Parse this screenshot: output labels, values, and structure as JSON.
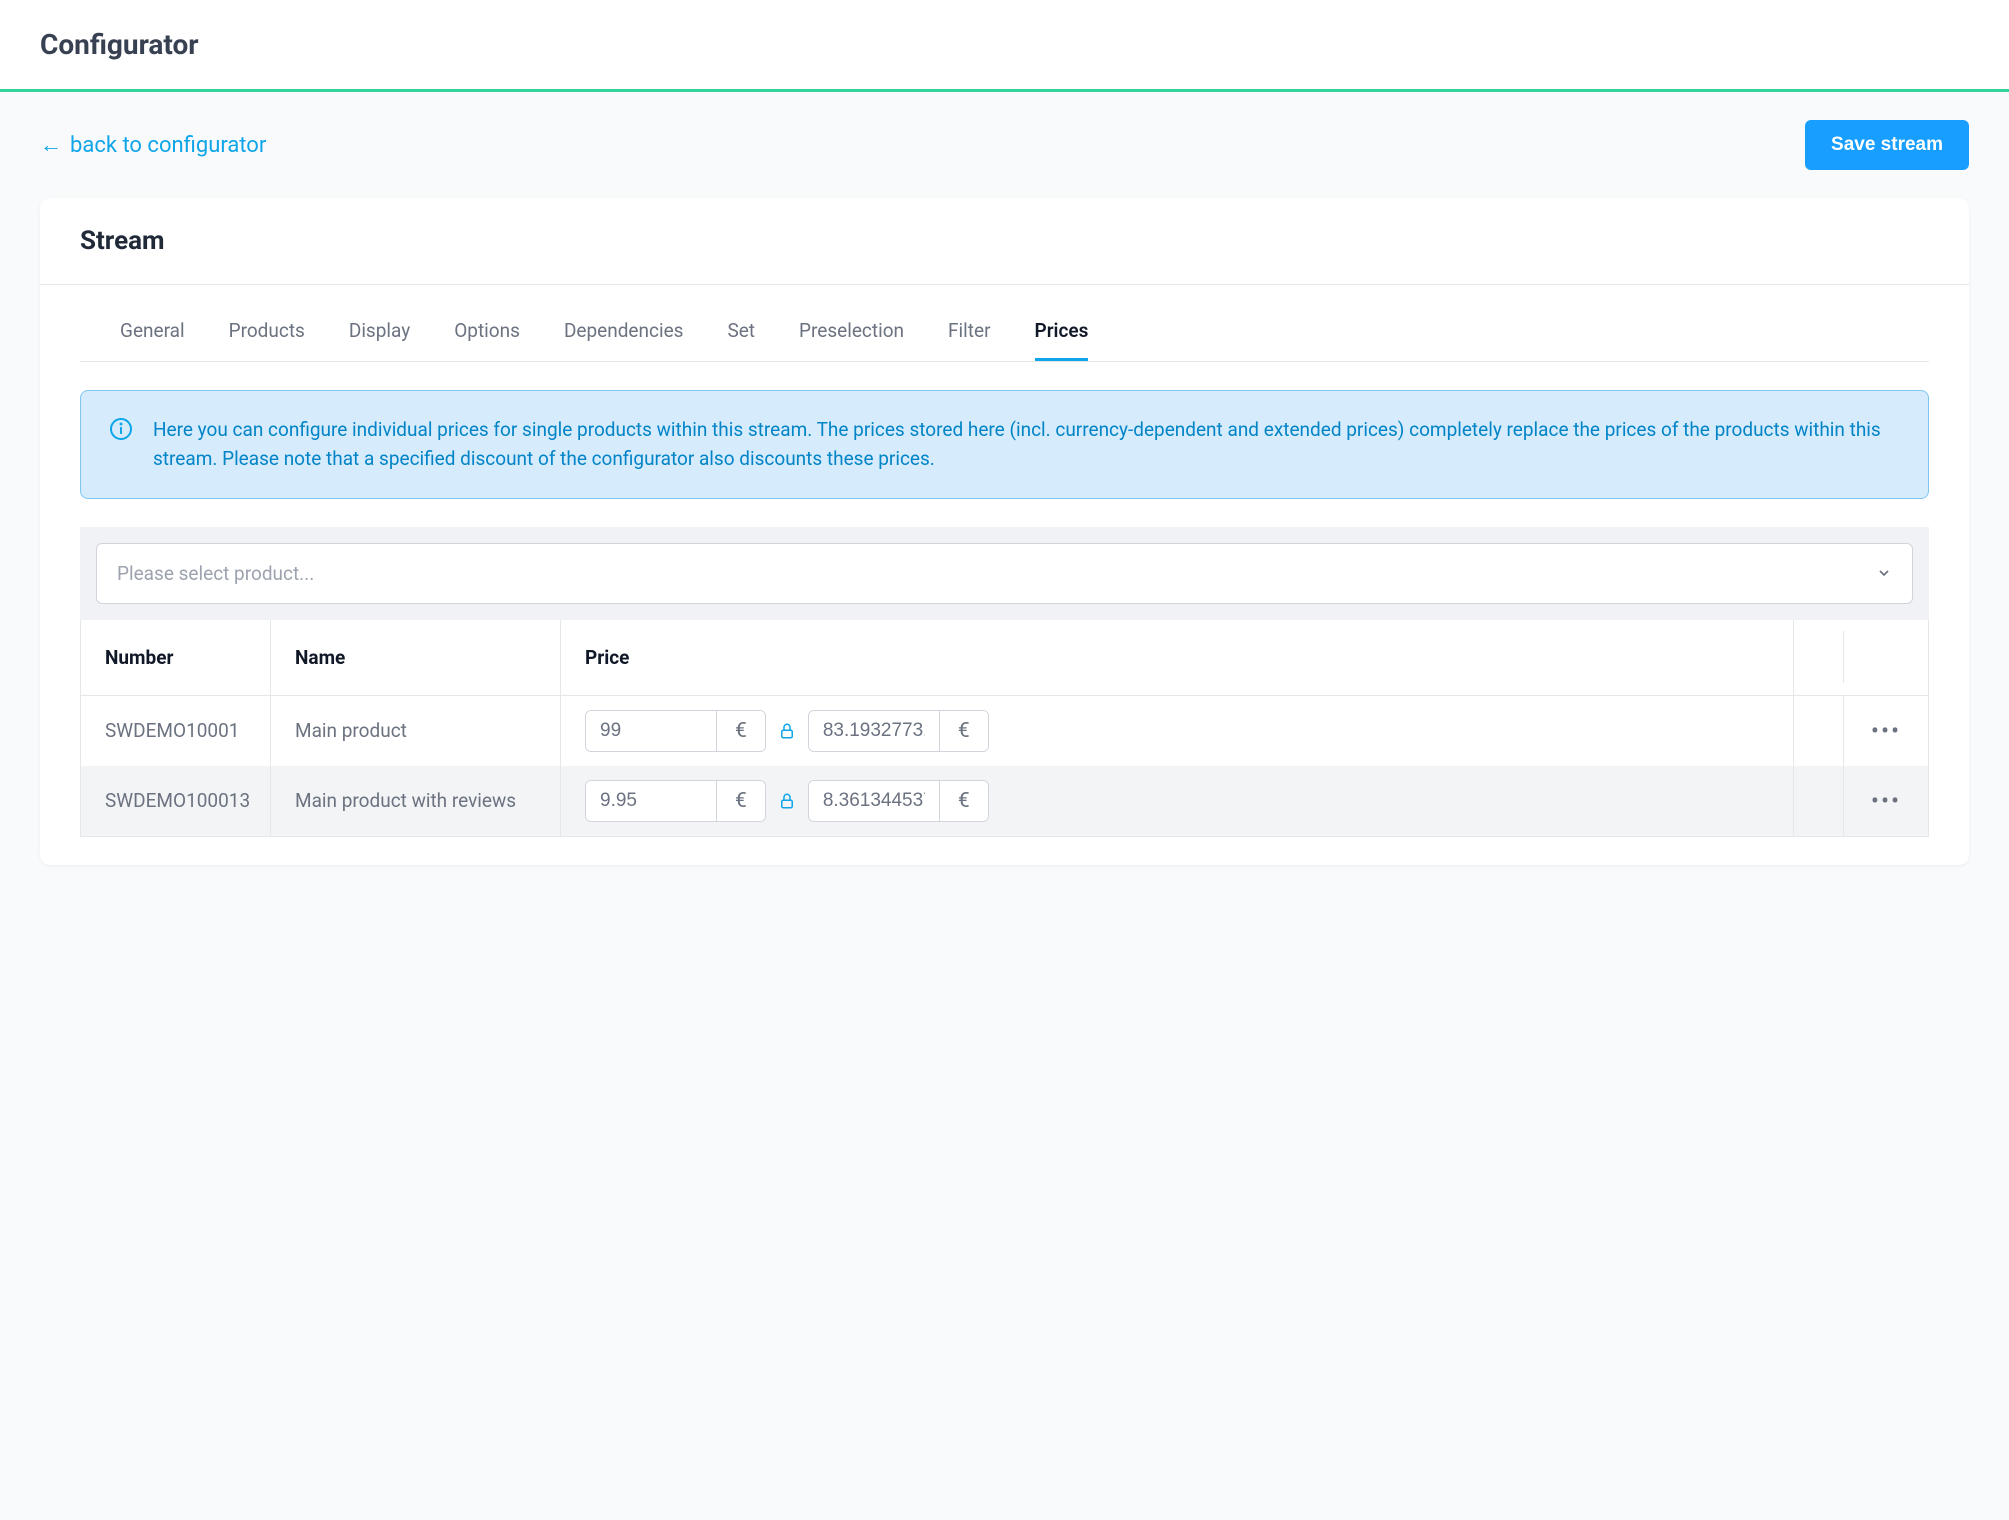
{
  "page": {
    "title": "Configurator"
  },
  "actions": {
    "back_label": "back to configurator",
    "save_label": "Save stream"
  },
  "card": {
    "title": "Stream"
  },
  "tabs": [
    {
      "label": "General"
    },
    {
      "label": "Products"
    },
    {
      "label": "Display"
    },
    {
      "label": "Options"
    },
    {
      "label": "Dependencies"
    },
    {
      "label": "Set"
    },
    {
      "label": "Preselection"
    },
    {
      "label": "Filter"
    },
    {
      "label": "Prices"
    }
  ],
  "info": {
    "text": "Here you can configure individual prices for single products within this stream. The prices stored here (incl. currency-dependent and extended prices) completely replace the prices of the products within this stream. Please note that a specified discount of the configurator also discounts these prices."
  },
  "select": {
    "placeholder": "Please select product..."
  },
  "table": {
    "headers": {
      "number": "Number",
      "name": "Name",
      "price": "Price"
    },
    "rows": [
      {
        "number": "SWDEMO10001",
        "name": "Main product",
        "price_gross": "99",
        "price_net": "83.19327731092",
        "currency": "€"
      },
      {
        "number": "SWDEMO100013",
        "name": "Main product with reviews",
        "price_gross": "9.95",
        "price_net": "8.361344537815",
        "currency": "€"
      }
    ]
  }
}
